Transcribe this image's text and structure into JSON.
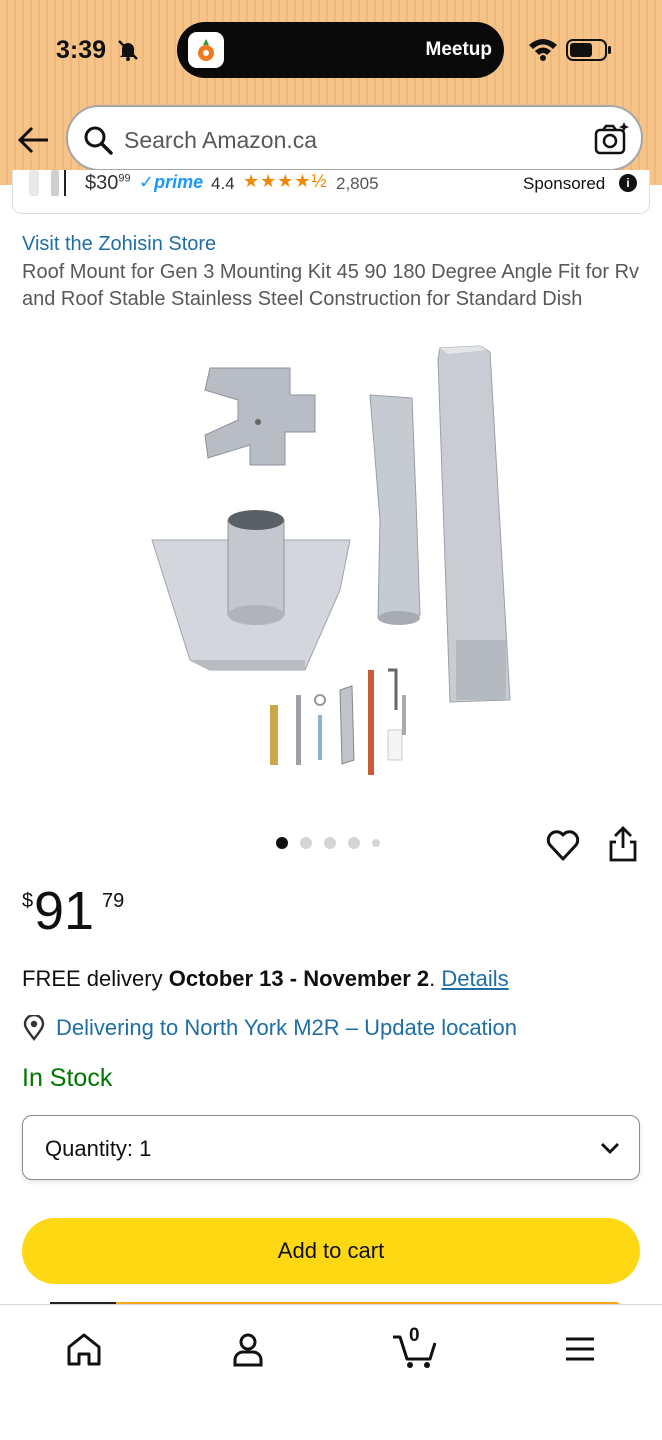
{
  "status_bar": {
    "time": "3:39",
    "island_label": "Meetup",
    "icons": [
      "bell-slash-icon",
      "wifi-icon",
      "battery-icon"
    ]
  },
  "header": {
    "search_placeholder": "Search Amazon.ca",
    "icons": [
      "back-arrow-icon",
      "search-icon",
      "camera-search-icon"
    ]
  },
  "sponsored": {
    "price_whole": "30",
    "price_fraction": "99",
    "prime": "prime",
    "rating": "4.4",
    "stars": "★★★★½",
    "review_count": "2,805",
    "label": "Sponsored"
  },
  "product": {
    "store_link": "Visit the Zohisin Store",
    "title": "Roof Mount for Gen 3 Mounting Kit 45 90 180 Degree Angle Fit for Rv and Roof Stable Stainless Steel Construction for Standard Dish",
    "image_count": 5,
    "active_image": 1,
    "price": {
      "currency": "$",
      "whole": "91",
      "fraction": "79"
    },
    "delivery": {
      "prefix": "FREE delivery ",
      "dates": "October 13 - November 2",
      "suffix": ". ",
      "link": "Details"
    },
    "location": "Delivering to North York M2R – Update location",
    "stock": "In Stock",
    "quantity_label": "Quantity:",
    "quantity_value": "1",
    "add_to_cart": "Add to cart"
  },
  "bottom_nav": {
    "cart_count": "0",
    "items": [
      "home-icon",
      "account-icon",
      "cart-icon",
      "menu-icon"
    ]
  },
  "colors": {
    "header_bg": "#f6c389",
    "link": "#1f6ea3",
    "in_stock": "#007600",
    "add_to_cart": "#ffd814",
    "buy_now": "#ffa41c"
  }
}
